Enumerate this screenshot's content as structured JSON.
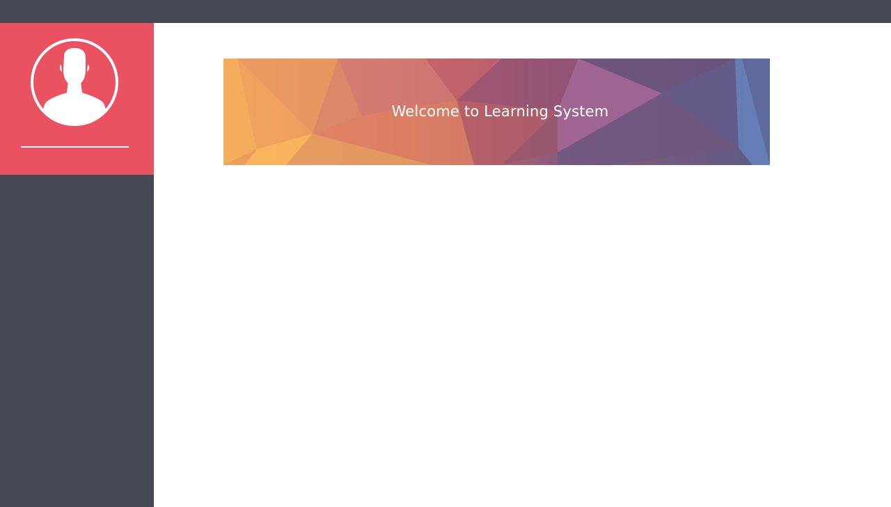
{
  "banner": {
    "title": "Welcome to Learning System"
  },
  "sidebar": {
    "avatar_icon": "user-silhouette-icon"
  },
  "colors": {
    "topbar": "#434852",
    "sidebar": "#434852",
    "profile_panel": "#ea5262",
    "content_background": "#ffffff"
  }
}
